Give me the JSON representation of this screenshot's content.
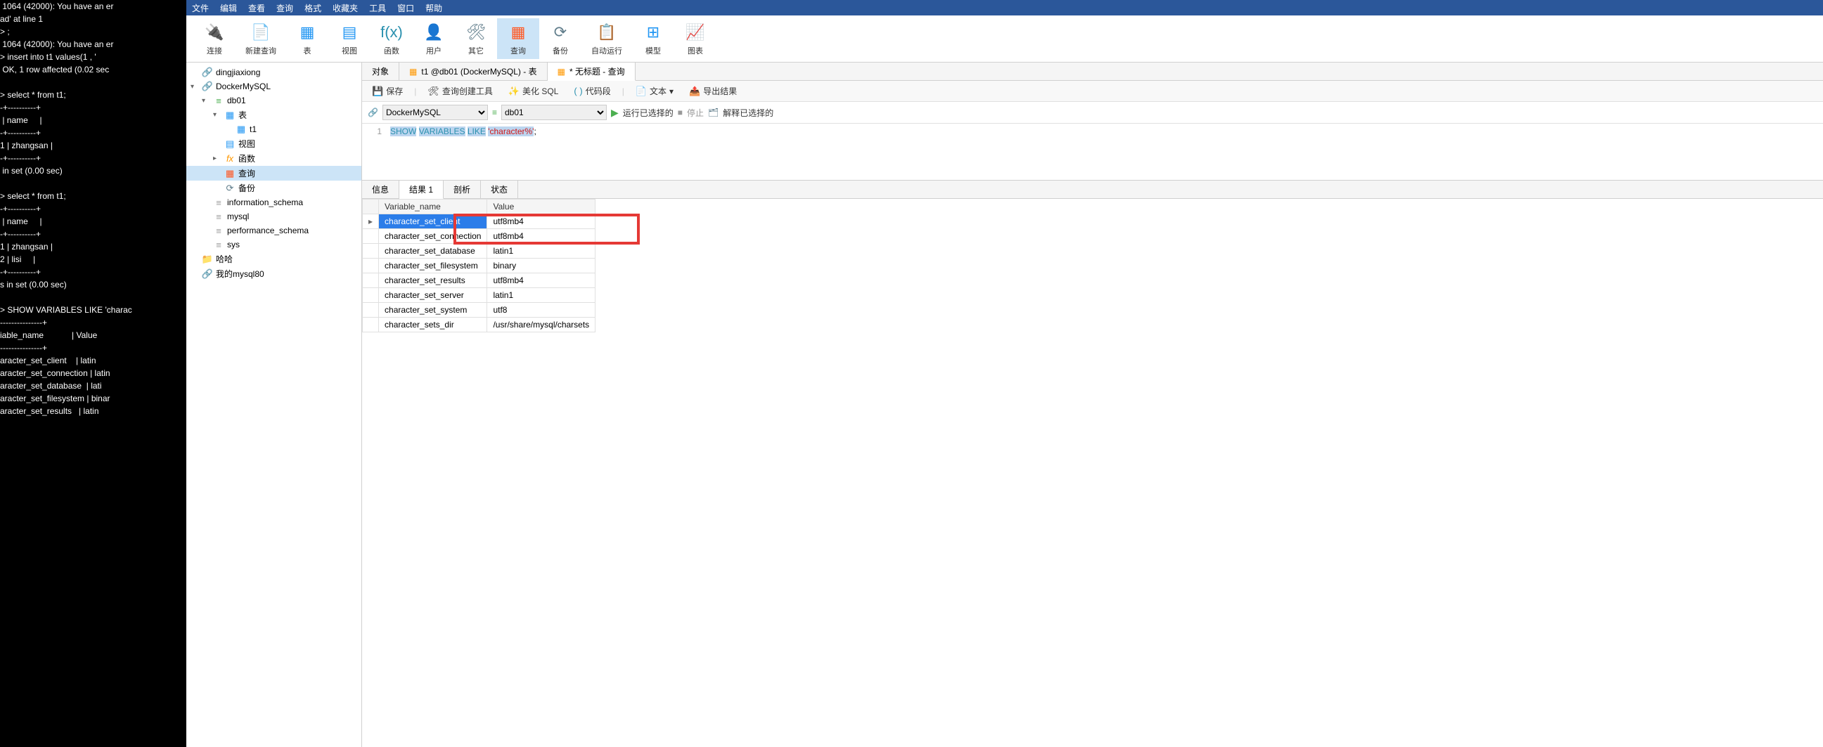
{
  "terminal_text": " 1064 (42000): You have an er\nad' at line 1\n> ;\n 1064 (42000): You have an er\n> insert into t1 values(1 , '\n OK, 1 row affected (0.02 sec\n\n> select * from t1;\n-+----------+\n | name     |\n-+----------+\n1 | zhangsan |\n-+----------+\n in set (0.00 sec)\n\n> select * from t1;\n-+----------+\n | name     |\n-+----------+\n1 | zhangsan |\n2 | lisi     |\n-+----------+\ns in set (0.00 sec)\n\n> SHOW VARIABLES LIKE 'charac\n---------------+\niable_name            | Value\n---------------+\naracter_set_client    | latin\naracter_set_connection | latin\naracter_set_database  | lati\naracter_set_filesystem | binar\naracter_set_results   | latin",
  "menu": [
    "文件",
    "编辑",
    "查看",
    "查询",
    "格式",
    "收藏夹",
    "工具",
    "窗口",
    "帮助"
  ],
  "ribbon": [
    {
      "label": "连接",
      "icon": "🔌",
      "color": "#607d8b"
    },
    {
      "label": "新建查询",
      "icon": "📄",
      "color": "#ff9800"
    },
    {
      "label": "表",
      "icon": "▦",
      "color": "#2196f3"
    },
    {
      "label": "视图",
      "icon": "▤",
      "color": "#2196f3"
    },
    {
      "label": "函数",
      "icon": "f(x)",
      "color": "#2b91af"
    },
    {
      "label": "用户",
      "icon": "👤",
      "color": "#ff9800"
    },
    {
      "label": "其它",
      "icon": "🛠",
      "color": "#607d8b"
    },
    {
      "label": "查询",
      "icon": "▦",
      "color": "#ff5722",
      "active": true
    },
    {
      "label": "备份",
      "icon": "⟳",
      "color": "#607d8b"
    },
    {
      "label": "自动运行",
      "icon": "📋",
      "color": "#4caf50"
    },
    {
      "label": "模型",
      "icon": "⊞",
      "color": "#2196f3"
    },
    {
      "label": "图表",
      "icon": "📈",
      "color": "#e91e63"
    }
  ],
  "tree": [
    {
      "indent": 0,
      "toggle": "",
      "icon": "🔗",
      "cls": "ico-conn",
      "label": "dingjiaxiong"
    },
    {
      "indent": 0,
      "toggle": "▾",
      "icon": "🔗",
      "cls": "ico-conn",
      "label": "DockerMySQL"
    },
    {
      "indent": 1,
      "toggle": "▾",
      "icon": "≡",
      "cls": "ico-db",
      "label": "db01"
    },
    {
      "indent": 2,
      "toggle": "▾",
      "icon": "▦",
      "cls": "ico-table",
      "label": "表"
    },
    {
      "indent": 3,
      "toggle": "",
      "icon": "▦",
      "cls": "ico-table",
      "label": "t1"
    },
    {
      "indent": 2,
      "toggle": "",
      "icon": "▤",
      "cls": "ico-view",
      "label": "视图"
    },
    {
      "indent": 2,
      "toggle": "▸",
      "icon": "fx",
      "cls": "ico-func",
      "label": "函数"
    },
    {
      "indent": 2,
      "toggle": "",
      "icon": "▦",
      "cls": "ico-query",
      "label": "查询",
      "selected": true
    },
    {
      "indent": 2,
      "toggle": "",
      "icon": "⟳",
      "cls": "ico-backup",
      "label": "备份"
    },
    {
      "indent": 1,
      "toggle": "",
      "icon": "≡",
      "cls": "ico-dbgray",
      "label": "information_schema"
    },
    {
      "indent": 1,
      "toggle": "",
      "icon": "≡",
      "cls": "ico-dbgray",
      "label": "mysql"
    },
    {
      "indent": 1,
      "toggle": "",
      "icon": "≡",
      "cls": "ico-dbgray",
      "label": "performance_schema"
    },
    {
      "indent": 1,
      "toggle": "",
      "icon": "≡",
      "cls": "ico-dbgray",
      "label": "sys"
    },
    {
      "indent": 0,
      "toggle": "",
      "icon": "📁",
      "cls": "ico-folder",
      "label": "哈哈"
    },
    {
      "indent": 0,
      "toggle": "",
      "icon": "🔗",
      "cls": "ico-conn",
      "label": "我的mysql80"
    }
  ],
  "tabs": [
    {
      "label": "对象",
      "icon": ""
    },
    {
      "label": "t1 @db01 (DockerMySQL) - 表",
      "icon": "▦"
    },
    {
      "label": "* 无标题 - 查询",
      "icon": "▦",
      "active": true
    }
  ],
  "qtoolbar": {
    "save": "保存",
    "builder": "查询创建工具",
    "beautify": "美化 SQL",
    "snippet": "代码段",
    "text": "文本",
    "export": "导出结果"
  },
  "selectors": {
    "connection": "DockerMySQL",
    "database": "db01",
    "run": "运行已选择的",
    "stop": "停止",
    "explain": "解释已选择的"
  },
  "sql": {
    "line_no": "1",
    "kw1": "SHOW",
    "kw2": "VARIABLES",
    "kw3": "LIKE",
    "str": "'character%'",
    "semi": ";"
  },
  "rtabs": [
    "信息",
    "结果 1",
    "剖析",
    "状态"
  ],
  "result": {
    "cols": [
      "Variable_name",
      "Value"
    ],
    "rows": [
      {
        "name": "character_set_client",
        "value": "utf8mb4",
        "selected": true
      },
      {
        "name": "character_set_connection",
        "value": "utf8mb4"
      },
      {
        "name": "character_set_database",
        "value": "latin1"
      },
      {
        "name": "character_set_filesystem",
        "value": "binary"
      },
      {
        "name": "character_set_results",
        "value": "utf8mb4"
      },
      {
        "name": "character_set_server",
        "value": "latin1"
      },
      {
        "name": "character_set_system",
        "value": "utf8"
      },
      {
        "name": "character_sets_dir",
        "value": "/usr/share/mysql/charsets"
      }
    ]
  }
}
